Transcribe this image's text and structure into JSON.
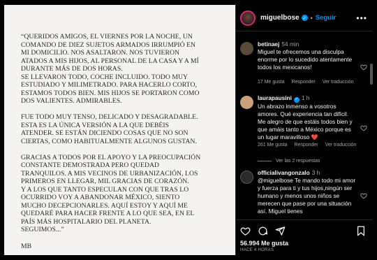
{
  "post": {
    "letter_paragraphs": [
      "“QUERIDOS AMIGOS, EL VIERNES POR LA NOCHE, UN\nCOMANDO DE DIEZ SUJETOS ARMADOS IRRUMPIÓ EN\nMI DOMICILIO. NOS ASALTARON. NOS TUVIERON\nATADOS A MIS HIJOS, AL PERSONAL DE LA CASA Y A MÍ\nDURANTE MÁS DE DOS HORAS.\nSE LLEVARON TODO, COCHE INCLUIDO. TODO MUY\nESTUDIADO Y MILIMETRADO. PARA HACERLO CORTO,\nESTAMOS TODOS BIEN. MIS HIJOS SE PORTARON COMO\nDOS VALIENTES. ADMIRABLES.",
      "FUE TODO MUY TENSO, DELICADO Y DESAGRADABLE.\nESTA ES LA ÚNICA VERSIÓN A LA QUE DEBÉIS\nATENDER. SE ESTÁN DICIENDO COSAS QUE NO SON\nCIERTAS, COMO HABITUALMENTE ALGUNOS GUSTAN.",
      "GRACIAS A TODOS POR EL APOYO Y LA PREOCUPACIÓN\nCONSTANTE DEMOSTRADA PERO QUEDAD\nTRANQUILOS. A MIS VECINOS DE URBANIZACIÓN, LOS\nPRIMEROS EN LLEGAR, MIL GRACIAS DE CORAZÓN.\nY A LOS QUE TANTO ESPECULAN CON QUE TRAS LO\nOCURRIDO VOY A ABANDONAR MÉXICO, SIENTO\nMUCHO DECEPCIONARLES. AQUÍ ESTOY Y AQUÍ ME\nQUEDARÉ PARA HACER FRENTE A LO QUE SEA, EN EL\nPAÍS MÁS HOSPITALARIO DEL PLANETA.\nSEGUIMOS...”"
    ],
    "signature": "MB"
  },
  "header": {
    "username": "miguelbose",
    "verified_mark": "✓",
    "separator": "•",
    "follow_label": "Seguir",
    "more_label": "•••"
  },
  "comments": [
    {
      "username": "betinaej",
      "time": "54 min",
      "text": "Miguel te ofrecemos una disculpa enorme por lo sucedido atentamente todos los mexicanos!",
      "likes": "17 Me gusta",
      "reply": "Responder",
      "translate": "Ver traducción",
      "avatar_color": "#5a4a3a"
    },
    {
      "username": "laurapausini",
      "verified_mark": "✓",
      "time": "1 h",
      "text": "Un abrazo inmenso a vosotros amores. Qué experiencia tan difícil. Me alegro de que estáis todos bien y que amáis tanto a México porque es un lugar maravilloso",
      "emoji": "❤️",
      "likes": "261 Me gusta",
      "reply": "Responder",
      "translate": "Ver traducción",
      "view_replies": "Ver las 2 respuestas",
      "avatar_color": "#c9a17a"
    },
    {
      "username": "officialivangonzalo",
      "time": "3 h",
      "text": "@miguelbose Te mando todo mi amor y fuerza para ti y tus hijos,ningún ser humano y menos unos niños se merecen que pase por una situación así. Miguel tienes",
      "avatar_color": "#2a2a2a"
    }
  ],
  "actions": {
    "like_icon": "heart-icon",
    "comment_icon": "comment-icon",
    "share_icon": "share-icon",
    "save_icon": "bookmark-icon",
    "likes_count": "56.994 Me gusta",
    "time_ago": "HACE 4 HORAS"
  },
  "colors": {
    "link_blue": "#0095f6",
    "muted": "#a8a8a8",
    "like_red": "#ed4956"
  }
}
